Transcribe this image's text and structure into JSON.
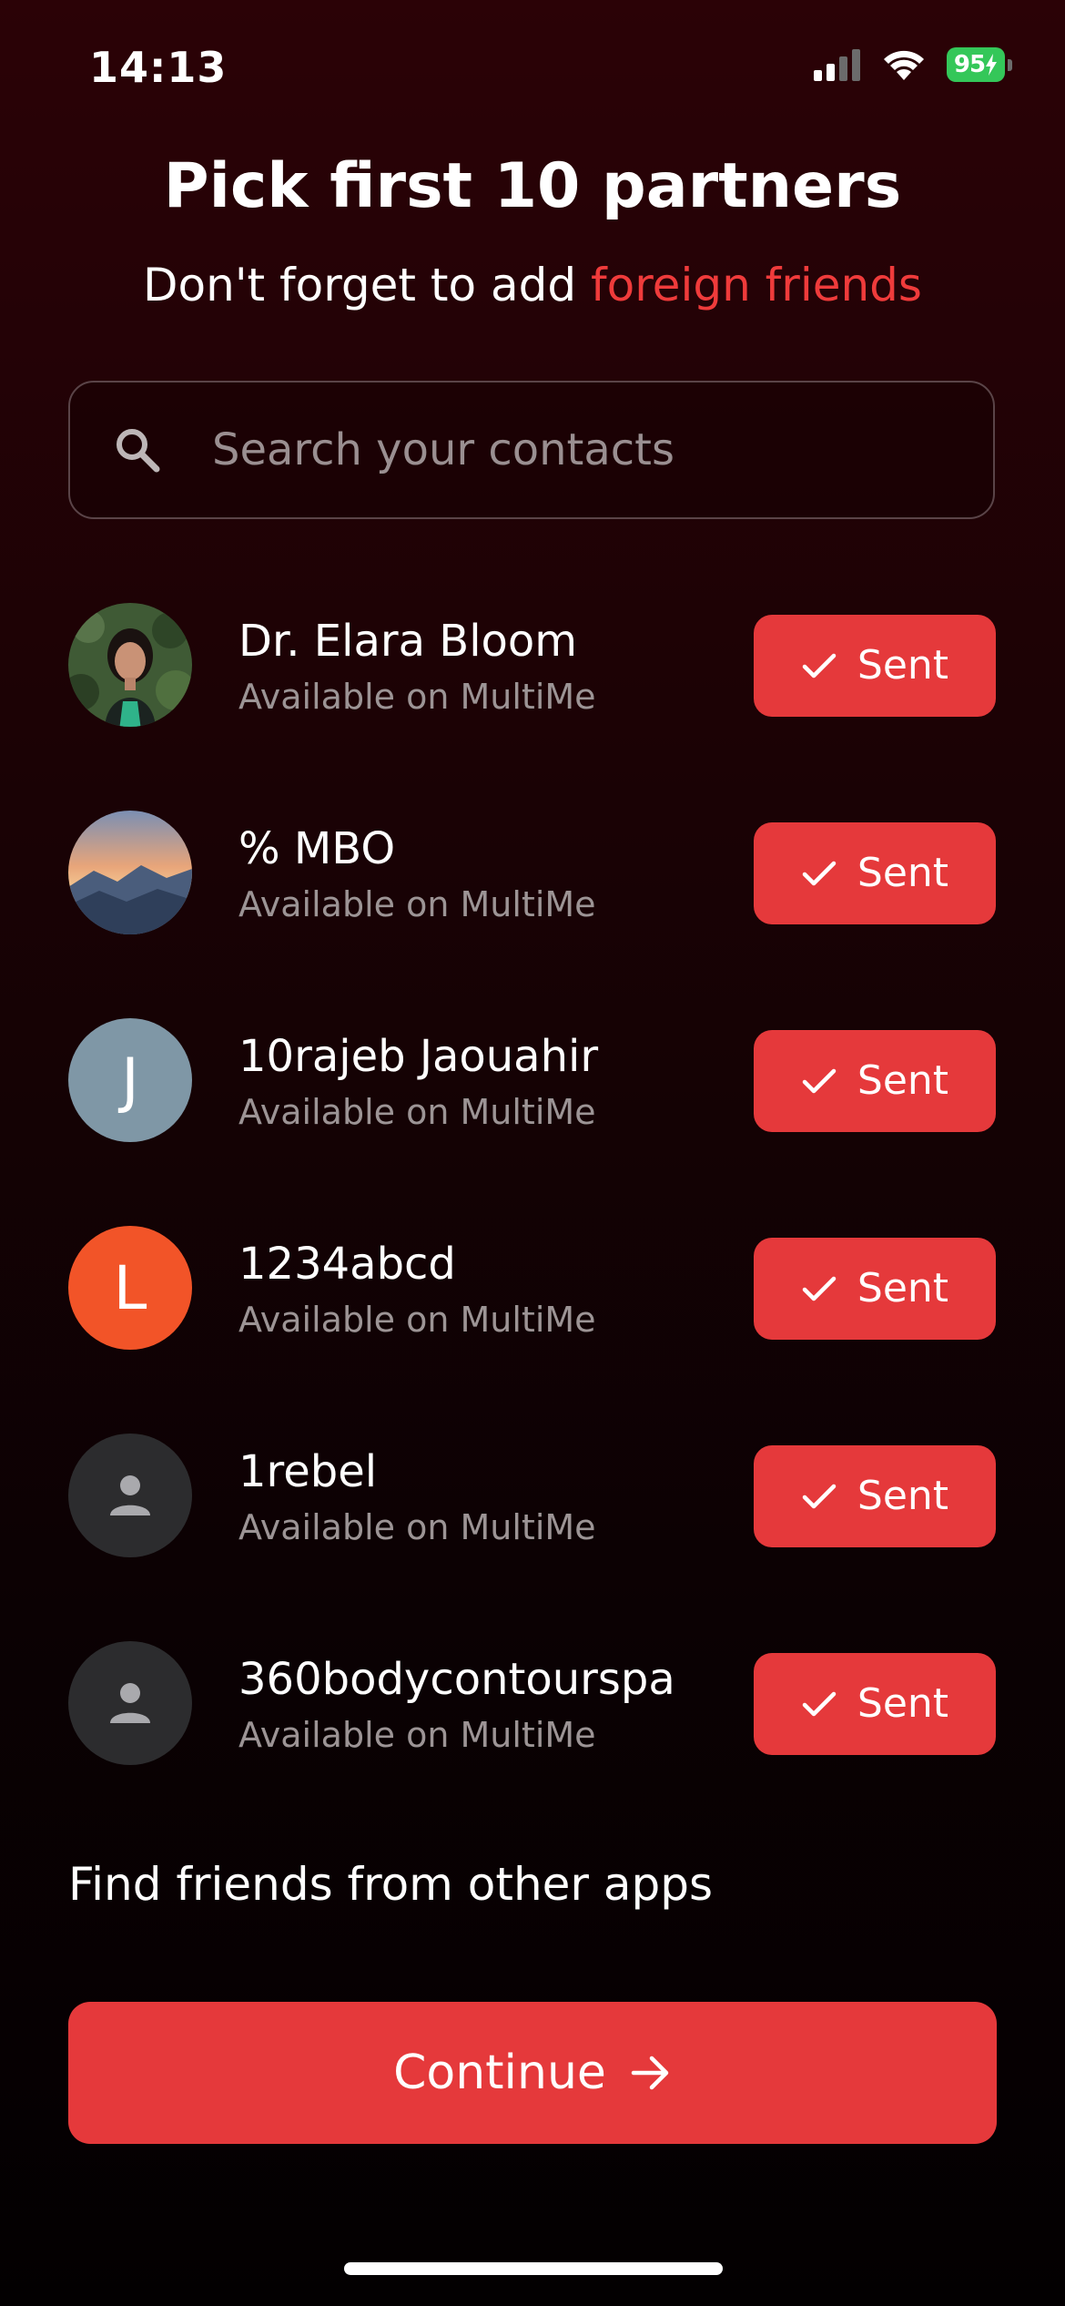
{
  "status_bar": {
    "time": "14:13",
    "battery_level": "95",
    "icons": [
      "signal-icon",
      "wifi-icon",
      "battery-charging-icon"
    ]
  },
  "header": {
    "title": "Pick first 10 partners",
    "subtitle_prefix": "Don't forget to add ",
    "subtitle_accent": "foreign friends"
  },
  "search": {
    "placeholder": "Search your contacts",
    "value": "",
    "icon": "search-icon"
  },
  "contacts": [
    {
      "name": "Dr. Elara Bloom",
      "status": "Available on MultiMe",
      "avatar_type": "photo-portrait",
      "button_label": "Sent"
    },
    {
      "name": "% MBO",
      "status": "Available on MultiMe",
      "avatar_type": "photo-landscape",
      "button_label": "Sent"
    },
    {
      "name": "10rajeb Jaouahir",
      "status": "Available on MultiMe",
      "avatar_type": "letter",
      "avatar_letter": "J",
      "button_label": "Sent"
    },
    {
      "name": "1234abcd",
      "status": "Available on MultiMe",
      "avatar_type": "letter",
      "avatar_letter": "L",
      "button_label": "Sent"
    },
    {
      "name": "1rebel",
      "status": "Available on MultiMe",
      "avatar_type": "generic-person",
      "button_label": "Sent"
    },
    {
      "name": "360bodycontourspa",
      "status": "Available on MultiMe",
      "avatar_type": "generic-person",
      "button_label": "Sent"
    }
  ],
  "find_friends_label": "Find friends from other apps",
  "continue_label": "Continue",
  "colors": {
    "accent": "#e5393b",
    "accent_text": "#ef3b3b",
    "background_top": "#2b0206",
    "background_bottom": "#030001",
    "secondary_text": "#9c9495",
    "avatar_j": "#7f97a6",
    "avatar_l": "#f25428",
    "avatar_generic": "#2c2c2e"
  }
}
